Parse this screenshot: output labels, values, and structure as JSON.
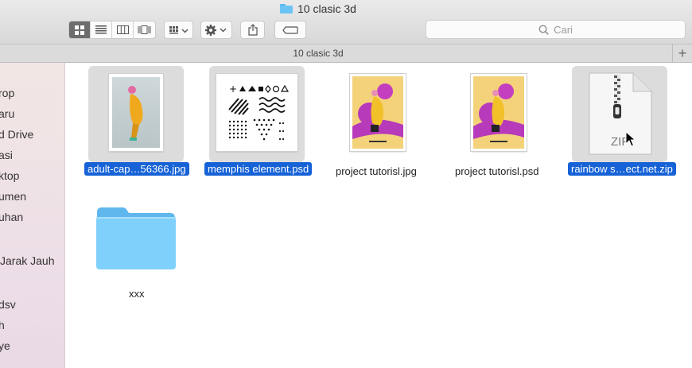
{
  "window": {
    "title": "10 clasic 3d"
  },
  "toolbar": {
    "view_buttons": [
      "icon-view",
      "list-view",
      "column-view",
      "cover-flow-view"
    ],
    "search_placeholder": "Cari"
  },
  "pathbar": {
    "title": "10 clasic 3d",
    "add_tab": "+"
  },
  "sidebar": {
    "items": [
      "rop",
      "aru",
      "d Drive",
      "asi",
      "ktop",
      "umen",
      "uhan",
      "Jarak Jauh",
      "dsv",
      "h",
      "ye"
    ]
  },
  "files": [
    {
      "name": "adult-cap…56366.jpg",
      "selected": true,
      "type": "jpg-photo"
    },
    {
      "name": "memphis element.psd",
      "selected": true,
      "type": "psd-pattern"
    },
    {
      "name": "project tutorisl.jpg",
      "selected": false,
      "type": "jpg-poster"
    },
    {
      "name": "project tutorisl.psd",
      "selected": false,
      "type": "psd-poster"
    },
    {
      "name": "rainbow s…ect.net.zip",
      "selected": true,
      "type": "zip",
      "icon_text": "ZIP"
    },
    {
      "name": "xxx",
      "selected": false,
      "type": "folder"
    }
  ],
  "colors": {
    "selection": "#1662d6",
    "folder": "#6cc4f5",
    "accent_yellow": "#f2c028",
    "accent_magenta": "#c43ec0"
  }
}
